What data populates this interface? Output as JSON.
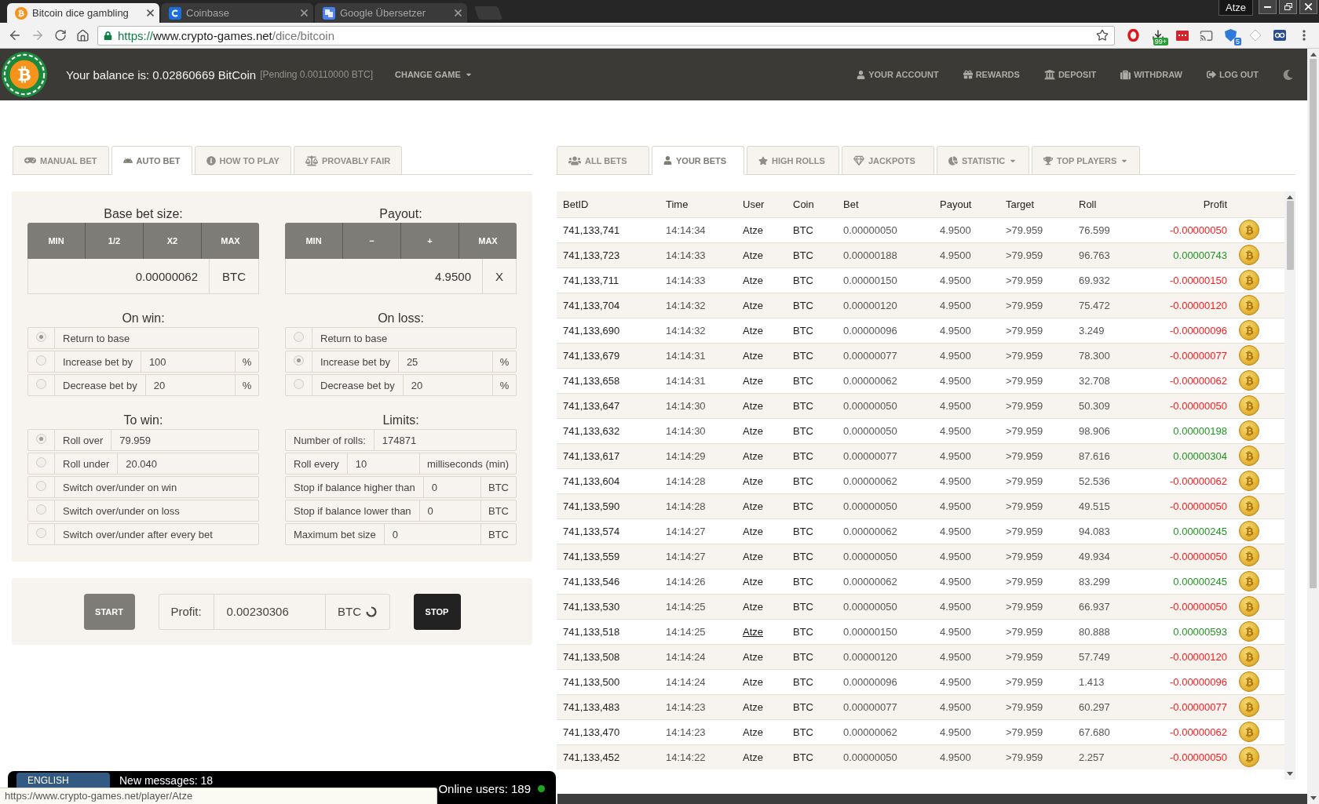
{
  "browser": {
    "tabs": [
      {
        "title": "Bitcoin dice gambling",
        "selected": true
      },
      {
        "title": "Coinbase",
        "selected": false
      },
      {
        "title": "Google Übersetzer",
        "selected": false
      }
    ],
    "profile": "Atze",
    "url": {
      "scheme": "https://",
      "host": "www.crypto-games.net",
      "path": "/dice/bitcoin"
    },
    "extension_badges": [
      "99+",
      "5"
    ]
  },
  "header": {
    "balance": "Your balance is: 0.02860669 BitCoin",
    "pending": "[Pending 0.00110000 BTC]",
    "change_game": "CHANGE GAME",
    "nav": [
      "YOUR ACCOUNT",
      "REWARDS",
      "DEPOSIT",
      "WITHDRAW",
      "LOG OUT"
    ]
  },
  "bet_tabs": [
    {
      "label": "MANUAL BET",
      "selected": false
    },
    {
      "label": "AUTO BET",
      "selected": true
    },
    {
      "label": "HOW TO PLAY",
      "selected": false
    },
    {
      "label": "PROVABLY FAIR",
      "selected": false
    }
  ],
  "base_bet": {
    "title": "Base bet size:",
    "buttons": [
      "MIN",
      "1/2",
      "X2",
      "MAX"
    ],
    "value": "0.00000062",
    "unit": "BTC"
  },
  "payout": {
    "title": "Payout:",
    "buttons": [
      "MIN",
      "−",
      "+",
      "MAX"
    ],
    "value": "4.9500",
    "unit": "X"
  },
  "on_win": {
    "title": "On win:",
    "options": [
      {
        "label": "Return to base",
        "selected": true
      },
      {
        "label": "Increase bet by",
        "value": "100",
        "unit": "%",
        "selected": false
      },
      {
        "label": "Decrease bet by",
        "value": "20",
        "unit": "%",
        "selected": false
      }
    ]
  },
  "on_loss": {
    "title": "On loss:",
    "options": [
      {
        "label": "Return to base",
        "selected": false
      },
      {
        "label": "Increase bet by",
        "value": "25",
        "unit": "%",
        "selected": true
      },
      {
        "label": "Decrease bet by",
        "value": "20",
        "unit": "%",
        "selected": false
      }
    ]
  },
  "to_win": {
    "title": "To win:",
    "options": [
      {
        "label": "Roll over",
        "value": "79.959",
        "selected": true
      },
      {
        "label": "Roll under",
        "value": "20.040",
        "selected": false
      },
      {
        "label": "Switch over/under on win",
        "selected": false
      },
      {
        "label": "Switch over/under on loss",
        "selected": false
      },
      {
        "label": "Switch over/under after every bet",
        "selected": false
      }
    ]
  },
  "limits": {
    "title": "Limits:",
    "rows": [
      {
        "label": "Number of rolls:",
        "value": "174871"
      },
      {
        "label": "Roll every",
        "value": "10",
        "unit": "milliseconds (min)"
      },
      {
        "label": "Stop if balance higher than",
        "value": "0",
        "unit": "BTC"
      },
      {
        "label": "Stop if balance lower than",
        "value": "0",
        "unit": "BTC"
      },
      {
        "label": "Maximum bet size",
        "value": "0",
        "unit": "BTC"
      }
    ]
  },
  "controls": {
    "start": "START",
    "profit_label": "Profit:",
    "profit": "0.00230306",
    "profit_unit": "BTC",
    "stop": "STOP"
  },
  "bets_tabs": [
    {
      "label": "ALL BETS",
      "selected": false,
      "dropdown": false
    },
    {
      "label": "YOUR BETS",
      "selected": true,
      "dropdown": false
    },
    {
      "label": "HIGH ROLLS",
      "selected": false,
      "dropdown": false
    },
    {
      "label": "JACKPOTS",
      "selected": false,
      "dropdown": false
    },
    {
      "label": "STATISTIC",
      "selected": false,
      "dropdown": true
    },
    {
      "label": "TOP PLAYERS",
      "selected": false,
      "dropdown": true
    }
  ],
  "bets_table": {
    "columns": [
      "BetID",
      "Time",
      "User",
      "Coin",
      "Bet",
      "Payout",
      "Target",
      "Roll",
      "Profit"
    ],
    "rows": [
      {
        "id": "741,133,741",
        "time": "14:14:34",
        "user": "Atze",
        "coin": "BTC",
        "bet": "0.00000050",
        "payout": "4.9500",
        "target": ">79.959",
        "roll": "76.599",
        "profit": "-0.00000050",
        "color": "#ff1a1a",
        "hovered": false
      },
      {
        "id": "741,133,723",
        "time": "14:14:33",
        "user": "Atze",
        "coin": "BTC",
        "bet": "0.00000188",
        "payout": "4.9500",
        "target": ">79.959",
        "roll": "96.763",
        "profit": "0.00000743",
        "color": "#1f951f",
        "hovered": false
      },
      {
        "id": "741,133,711",
        "time": "14:14:33",
        "user": "Atze",
        "coin": "BTC",
        "bet": "0.00000150",
        "payout": "4.9500",
        "target": ">79.959",
        "roll": "69.932",
        "profit": "-0.00000150",
        "color": "#ff1a1a",
        "hovered": false
      },
      {
        "id": "741,133,704",
        "time": "14:14:32",
        "user": "Atze",
        "coin": "BTC",
        "bet": "0.00000120",
        "payout": "4.9500",
        "target": ">79.959",
        "roll": "75.472",
        "profit": "-0.00000120",
        "color": "#ff1a1a",
        "hovered": false
      },
      {
        "id": "741,133,690",
        "time": "14:14:32",
        "user": "Atze",
        "coin": "BTC",
        "bet": "0.00000096",
        "payout": "4.9500",
        "target": ">79.959",
        "roll": "3.249",
        "profit": "-0.00000096",
        "color": "#ff1a1a",
        "hovered": false
      },
      {
        "id": "741,133,679",
        "time": "14:14:31",
        "user": "Atze",
        "coin": "BTC",
        "bet": "0.00000077",
        "payout": "4.9500",
        "target": ">79.959",
        "roll": "78.300",
        "profit": "-0.00000077",
        "color": "#ff1a1a",
        "hovered": false
      },
      {
        "id": "741,133,658",
        "time": "14:14:31",
        "user": "Atze",
        "coin": "BTC",
        "bet": "0.00000062",
        "payout": "4.9500",
        "target": ">79.959",
        "roll": "32.708",
        "profit": "-0.00000062",
        "color": "#ff1a1a",
        "hovered": false
      },
      {
        "id": "741,133,647",
        "time": "14:14:30",
        "user": "Atze",
        "coin": "BTC",
        "bet": "0.00000050",
        "payout": "4.9500",
        "target": ">79.959",
        "roll": "50.309",
        "profit": "-0.00000050",
        "color": "#ff1a1a",
        "hovered": false
      },
      {
        "id": "741,133,632",
        "time": "14:14:30",
        "user": "Atze",
        "coin": "BTC",
        "bet": "0.00000050",
        "payout": "4.9500",
        "target": ">79.959",
        "roll": "98.906",
        "profit": "0.00000198",
        "color": "#1f951f",
        "hovered": false
      },
      {
        "id": "741,133,617",
        "time": "14:14:29",
        "user": "Atze",
        "coin": "BTC",
        "bet": "0.00000077",
        "payout": "4.9500",
        "target": ">79.959",
        "roll": "87.616",
        "profit": "0.00000304",
        "color": "#1f951f",
        "hovered": false
      },
      {
        "id": "741,133,604",
        "time": "14:14:28",
        "user": "Atze",
        "coin": "BTC",
        "bet": "0.00000062",
        "payout": "4.9500",
        "target": ">79.959",
        "roll": "52.536",
        "profit": "-0.00000062",
        "color": "#ff1a1a",
        "hovered": false
      },
      {
        "id": "741,133,590",
        "time": "14:14:28",
        "user": "Atze",
        "coin": "BTC",
        "bet": "0.00000050",
        "payout": "4.9500",
        "target": ">79.959",
        "roll": "49.515",
        "profit": "-0.00000050",
        "color": "#ff1a1a",
        "hovered": false
      },
      {
        "id": "741,133,574",
        "time": "14:14:27",
        "user": "Atze",
        "coin": "BTC",
        "bet": "0.00000062",
        "payout": "4.9500",
        "target": ">79.959",
        "roll": "94.083",
        "profit": "0.00000245",
        "color": "#1f951f",
        "hovered": false
      },
      {
        "id": "741,133,559",
        "time": "14:14:27",
        "user": "Atze",
        "coin": "BTC",
        "bet": "0.00000050",
        "payout": "4.9500",
        "target": ">79.959",
        "roll": "49.934",
        "profit": "-0.00000050",
        "color": "#ff1a1a",
        "hovered": false
      },
      {
        "id": "741,133,546",
        "time": "14:14:26",
        "user": "Atze",
        "coin": "BTC",
        "bet": "0.00000062",
        "payout": "4.9500",
        "target": ">79.959",
        "roll": "83.299",
        "profit": "0.00000245",
        "color": "#1f951f",
        "hovered": false
      },
      {
        "id": "741,133,530",
        "time": "14:14:25",
        "user": "Atze",
        "coin": "BTC",
        "bet": "0.00000050",
        "payout": "4.9500",
        "target": ">79.959",
        "roll": "66.937",
        "profit": "-0.00000050",
        "color": "#ff1a1a",
        "hovered": false
      },
      {
        "id": "741,133,518",
        "time": "14:14:25",
        "user": "Atze",
        "coin": "BTC",
        "bet": "0.00000150",
        "payout": "4.9500",
        "target": ">79.959",
        "roll": "80.888",
        "profit": "0.00000593",
        "color": "#1f951f",
        "hovered": true
      },
      {
        "id": "741,133,508",
        "time": "14:14:24",
        "user": "Atze",
        "coin": "BTC",
        "bet": "0.00000120",
        "payout": "4.9500",
        "target": ">79.959",
        "roll": "57.749",
        "profit": "-0.00000120",
        "color": "#ff1a1a",
        "hovered": false
      },
      {
        "id": "741,133,500",
        "time": "14:14:24",
        "user": "Atze",
        "coin": "BTC",
        "bet": "0.00000096",
        "payout": "4.9500",
        "target": ">79.959",
        "roll": "1.413",
        "profit": "-0.00000096",
        "color": "#ff1a1a",
        "hovered": false
      },
      {
        "id": "741,133,483",
        "time": "14:14:23",
        "user": "Atze",
        "coin": "BTC",
        "bet": "0.00000077",
        "payout": "4.9500",
        "target": ">79.959",
        "roll": "60.297",
        "profit": "-0.00000077",
        "color": "#ff1a1a",
        "hovered": false
      },
      {
        "id": "741,133,470",
        "time": "14:14:23",
        "user": "Atze",
        "coin": "BTC",
        "bet": "0.00000062",
        "payout": "4.9500",
        "target": ">79.959",
        "roll": "67.680",
        "profit": "-0.00000062",
        "color": "#ff1a1a",
        "hovered": false
      },
      {
        "id": "741,133,452",
        "time": "14:14:22",
        "user": "Atze",
        "coin": "BTC",
        "bet": "0.00000050",
        "payout": "4.9500",
        "target": ">79.959",
        "roll": "2.257",
        "profit": "-0.00000050",
        "color": "#ff1a1a",
        "hovered": false
      }
    ]
  },
  "chat": {
    "language": "ENGLISH",
    "messages": "New messages: 18",
    "online": "Online users: 189"
  },
  "status_url": "https://www.crypto-games.net/player/Atze"
}
